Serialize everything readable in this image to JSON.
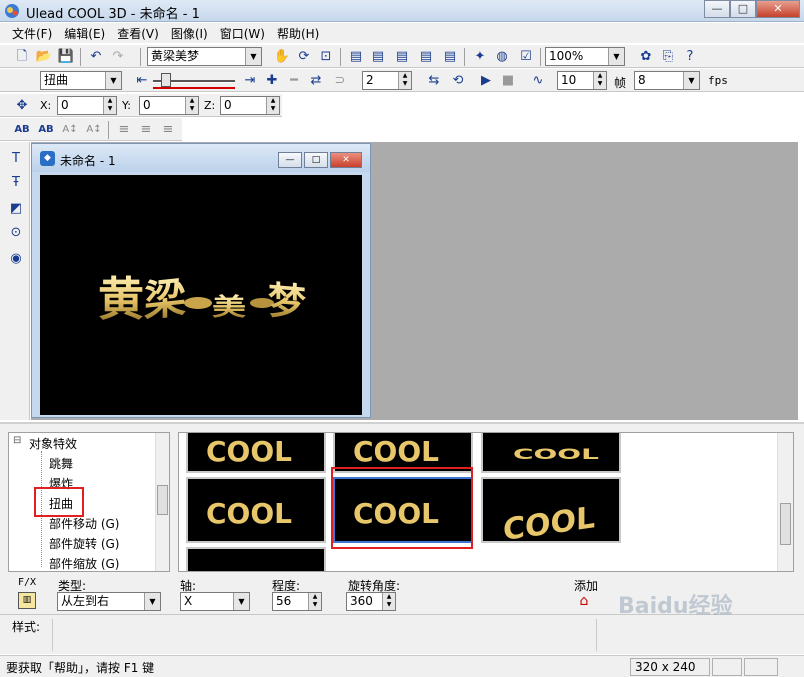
{
  "window": {
    "title": "Ulead COOL 3D - 未命名 - 1"
  },
  "menu": [
    "文件(F)",
    "编辑(E)",
    "查看(V)",
    "图像(I)",
    "窗口(W)",
    "帮助(H)"
  ],
  "toolbar": {
    "text_combo": "黄梁美梦",
    "zoom_combo": "100%",
    "effect_combo": "扭曲",
    "frame_value": "2",
    "total_frames_value": "10",
    "frames_label": "帧",
    "fps_value": "8",
    "fps_label": "fps"
  },
  "position": {
    "x_label": "X:",
    "x_value": "0",
    "y_label": "Y:",
    "y_value": "0",
    "z_label": "Z:",
    "z_value": "0"
  },
  "text_tools": [
    "AB",
    "AB",
    "A↕",
    "A↕"
  ],
  "document": {
    "title": "未命名 - 1",
    "canvas_text": "黄梁美梦"
  },
  "tree": {
    "root": "对象特效",
    "items": [
      "跳舞",
      "爆炸",
      "扭曲",
      "部件移动 (G)",
      "部件旋转 (G)",
      "部件缩放 (G)"
    ],
    "selected": "扭曲"
  },
  "gallery": {
    "thumb_text": "COOL",
    "selected_index": 4
  },
  "properties": {
    "fx_label": "F/X",
    "type_label": "类型:",
    "type_value": "从左到右",
    "axis_label": "轴:",
    "axis_value": "X",
    "degree_label": "程度:",
    "degree_value": "56",
    "rotation_label": "旋转角度:",
    "rotation_value": "360",
    "add_label": "添加"
  },
  "style_label": "样式:",
  "status": {
    "message": "要获取「帮助」，请按 F1 键",
    "size": "320 x 240"
  },
  "watermark": "Baidu经验",
  "colors": {
    "gold": "#e8c66a",
    "highlight_red": "#e02020",
    "selection_blue": "#3d74d6"
  }
}
